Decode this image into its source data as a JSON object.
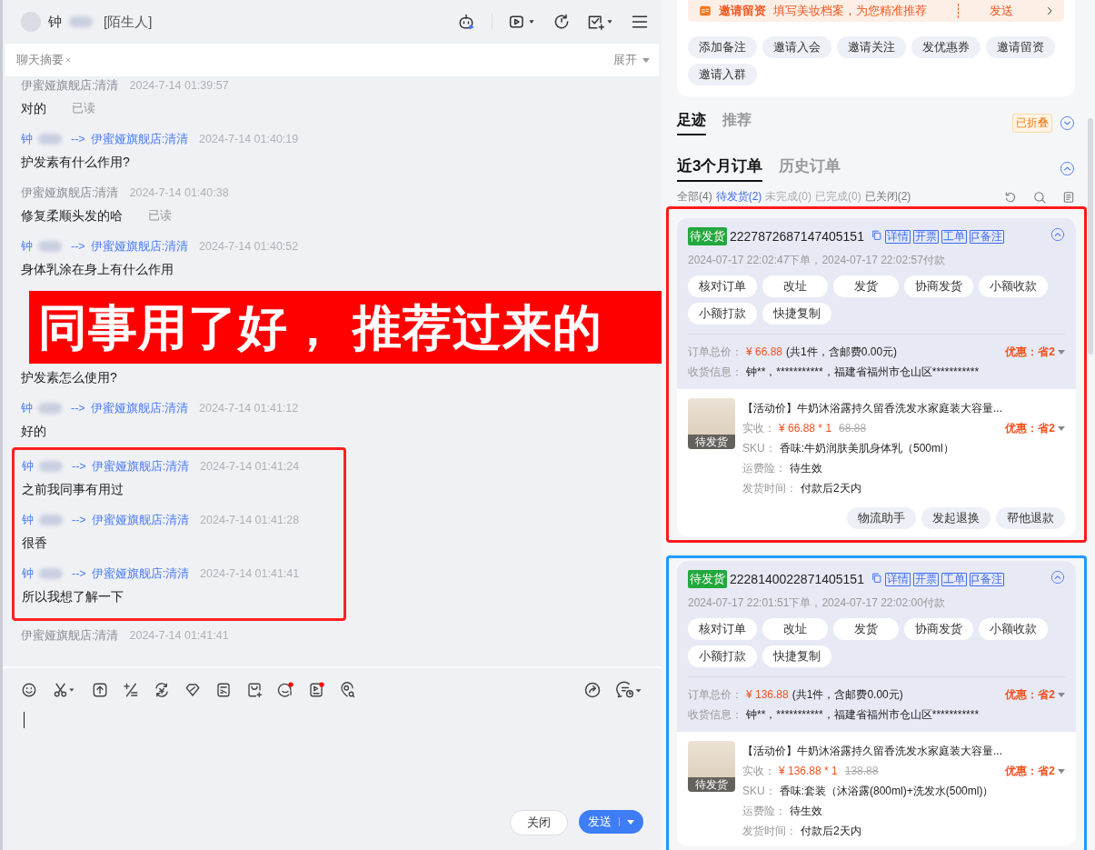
{
  "header": {
    "contact_name": "钟",
    "contact_tag": "[陌生人]"
  },
  "summary_bar": {
    "label": "聊天摘要",
    "expand": "展开"
  },
  "messages": [
    {
      "kind": "shop",
      "sender": "伊蜜娅旗舰店:清清",
      "time": "2024-7-14 01:39:57",
      "text": "对的",
      "read_label": "已读"
    },
    {
      "kind": "customer",
      "from": "钟",
      "arrow": "-->",
      "to": "伊蜜娅旗舰店:清清",
      "time": "2024-7-14 01:40:19",
      "text": "护发素有什么作用?"
    },
    {
      "kind": "shop",
      "sender": "伊蜜娅旗舰店:清清",
      "time": "2024-7-14 01:40:38",
      "text": "修复柔顺头发的哈",
      "read_label": "已读"
    },
    {
      "kind": "customer",
      "from": "钟",
      "arrow": "-->",
      "to": "伊蜜娅旗舰店:清清",
      "time": "2024-7-14 01:40:52",
      "text": "身体乳涂在身上有什么作用"
    },
    {
      "kind": "caption",
      "text": "同事用了好， 推荐过来的"
    },
    {
      "kind": "customer",
      "text": "护发素怎么使用?"
    },
    {
      "kind": "customer",
      "from": "钟",
      "arrow": "-->",
      "to": "伊蜜娅旗舰店:清清",
      "time": "2024-7-14 01:41:12",
      "text": "好的"
    },
    {
      "kind": "group",
      "color": "#ff2020",
      "messages": [
        {
          "kind": "customer",
          "from": "钟",
          "arrow": "-->",
          "to": "伊蜜娅旗舰店:清清",
          "time": "2024-7-14 01:41:24",
          "text": "之前我同事有用过"
        },
        {
          "kind": "customer",
          "from": "钟",
          "arrow": "-->",
          "to": "伊蜜娅旗舰店:清清",
          "time": "2024-7-14 01:41:28",
          "text": "很香"
        },
        {
          "kind": "customer",
          "from": "钟",
          "arrow": "-->",
          "to": "伊蜜娅旗舰店:清清",
          "time": "2024-7-14 01:41:41",
          "text": "所以我想了解一下"
        }
      ]
    },
    {
      "kind": "shop",
      "sender": "伊蜜娅旗舰店:清清",
      "time": "2024-7-14 01:41:41"
    }
  ],
  "composer": {
    "close": "关闭",
    "send": "发送"
  },
  "invite_banner": {
    "title": "邀请留资",
    "text": "填写美妆档案，为您精准推荐",
    "action": "发送"
  },
  "quick_actions": [
    "添加备注",
    "邀请入会",
    "邀请关注",
    "发优惠券",
    "邀请留资",
    "邀请入群"
  ],
  "tabs": [
    {
      "label": "足迹",
      "selected": true
    },
    {
      "label": "推荐",
      "selected": false
    }
  ],
  "fold_tag": "已折叠",
  "order_tabs": [
    {
      "label": "近3个月订单",
      "selected": true
    },
    {
      "label": "历史订单",
      "selected": false
    }
  ],
  "order_filters": [
    {
      "label": "全部(4)",
      "selected": false,
      "disabled": false
    },
    {
      "label": "待发货(2)",
      "selected": true,
      "disabled": false
    },
    {
      "label": "未完成(0)",
      "selected": false,
      "disabled": true
    },
    {
      "label": "已完成(0)",
      "selected": false,
      "disabled": true
    },
    {
      "label": "已关闭(2)",
      "selected": false,
      "disabled": false
    }
  ],
  "orders": [
    {
      "color": "#ff1a1a",
      "status": "待发货",
      "number": "2227872687147405151",
      "links": [
        "详情",
        "开票",
        "工单",
        "备注"
      ],
      "times": "2024-07-17 22:02:47下单，2024-07-17 22:02:57付款",
      "actions": [
        "核对订单",
        "改址",
        "发货",
        "协商发货",
        "小额收款",
        "小额打款",
        "快捷复制"
      ],
      "total_label": "订单总价：",
      "total": "¥ 66.88",
      "total_note": "(共1件，含邮费0.00元)",
      "discount": "优惠：省2",
      "address_label": "收货信息：",
      "address": "钟**，***********，福建省福州市仓山区***********",
      "item": {
        "title": "【活动价】牛奶沐浴露持久留香洗发水家庭装大容量...",
        "image_label": "待发货",
        "paid_label": "实收：",
        "paid": "¥ 66.88 * 1",
        "original": "68.88",
        "discount": "优惠：省2",
        "sku_label": "SKU：",
        "sku": "香味:牛奶润肤美肌身体乳（500ml）",
        "insurance_label": "运费险：",
        "insurance": "待生效",
        "ship_label": "发货时间：",
        "ship": "付款后2天内"
      },
      "buttons": [
        "物流助手",
        "发起退换",
        "帮他退款"
      ]
    },
    {
      "color": "#1e9bff",
      "status": "待发货",
      "number": "2228140022871405151",
      "links": [
        "详情",
        "开票",
        "工单",
        "备注"
      ],
      "times": "2024-07-17 22:01:51下单，2024-07-17 22:02:00付款",
      "actions": [
        "核对订单",
        "改址",
        "发货",
        "协商发货",
        "小额收款",
        "小额打款",
        "快捷复制"
      ],
      "total_label": "订单总价：",
      "total": "¥ 136.88",
      "total_note": "(共1件，含邮费0.00元)",
      "discount": "优惠：省2",
      "address_label": "收货信息：",
      "address": "钟**，***********，福建省福州市仓山区***********",
      "item": {
        "title": "【活动价】牛奶沐浴露持久留香洗发水家庭装大容量...",
        "image_label": "待发货",
        "paid_label": "实收：",
        "paid": "¥ 136.88 * 1",
        "original": "138.88",
        "discount": "优惠：省2",
        "sku_label": "SKU：",
        "sku": "香味:套装（沐浴露(800ml)+洗发水(500ml)）",
        "insurance_label": "运费险：",
        "insurance": "待生效",
        "ship_label": "发货时间：",
        "ship": "付款后2天内"
      }
    }
  ]
}
